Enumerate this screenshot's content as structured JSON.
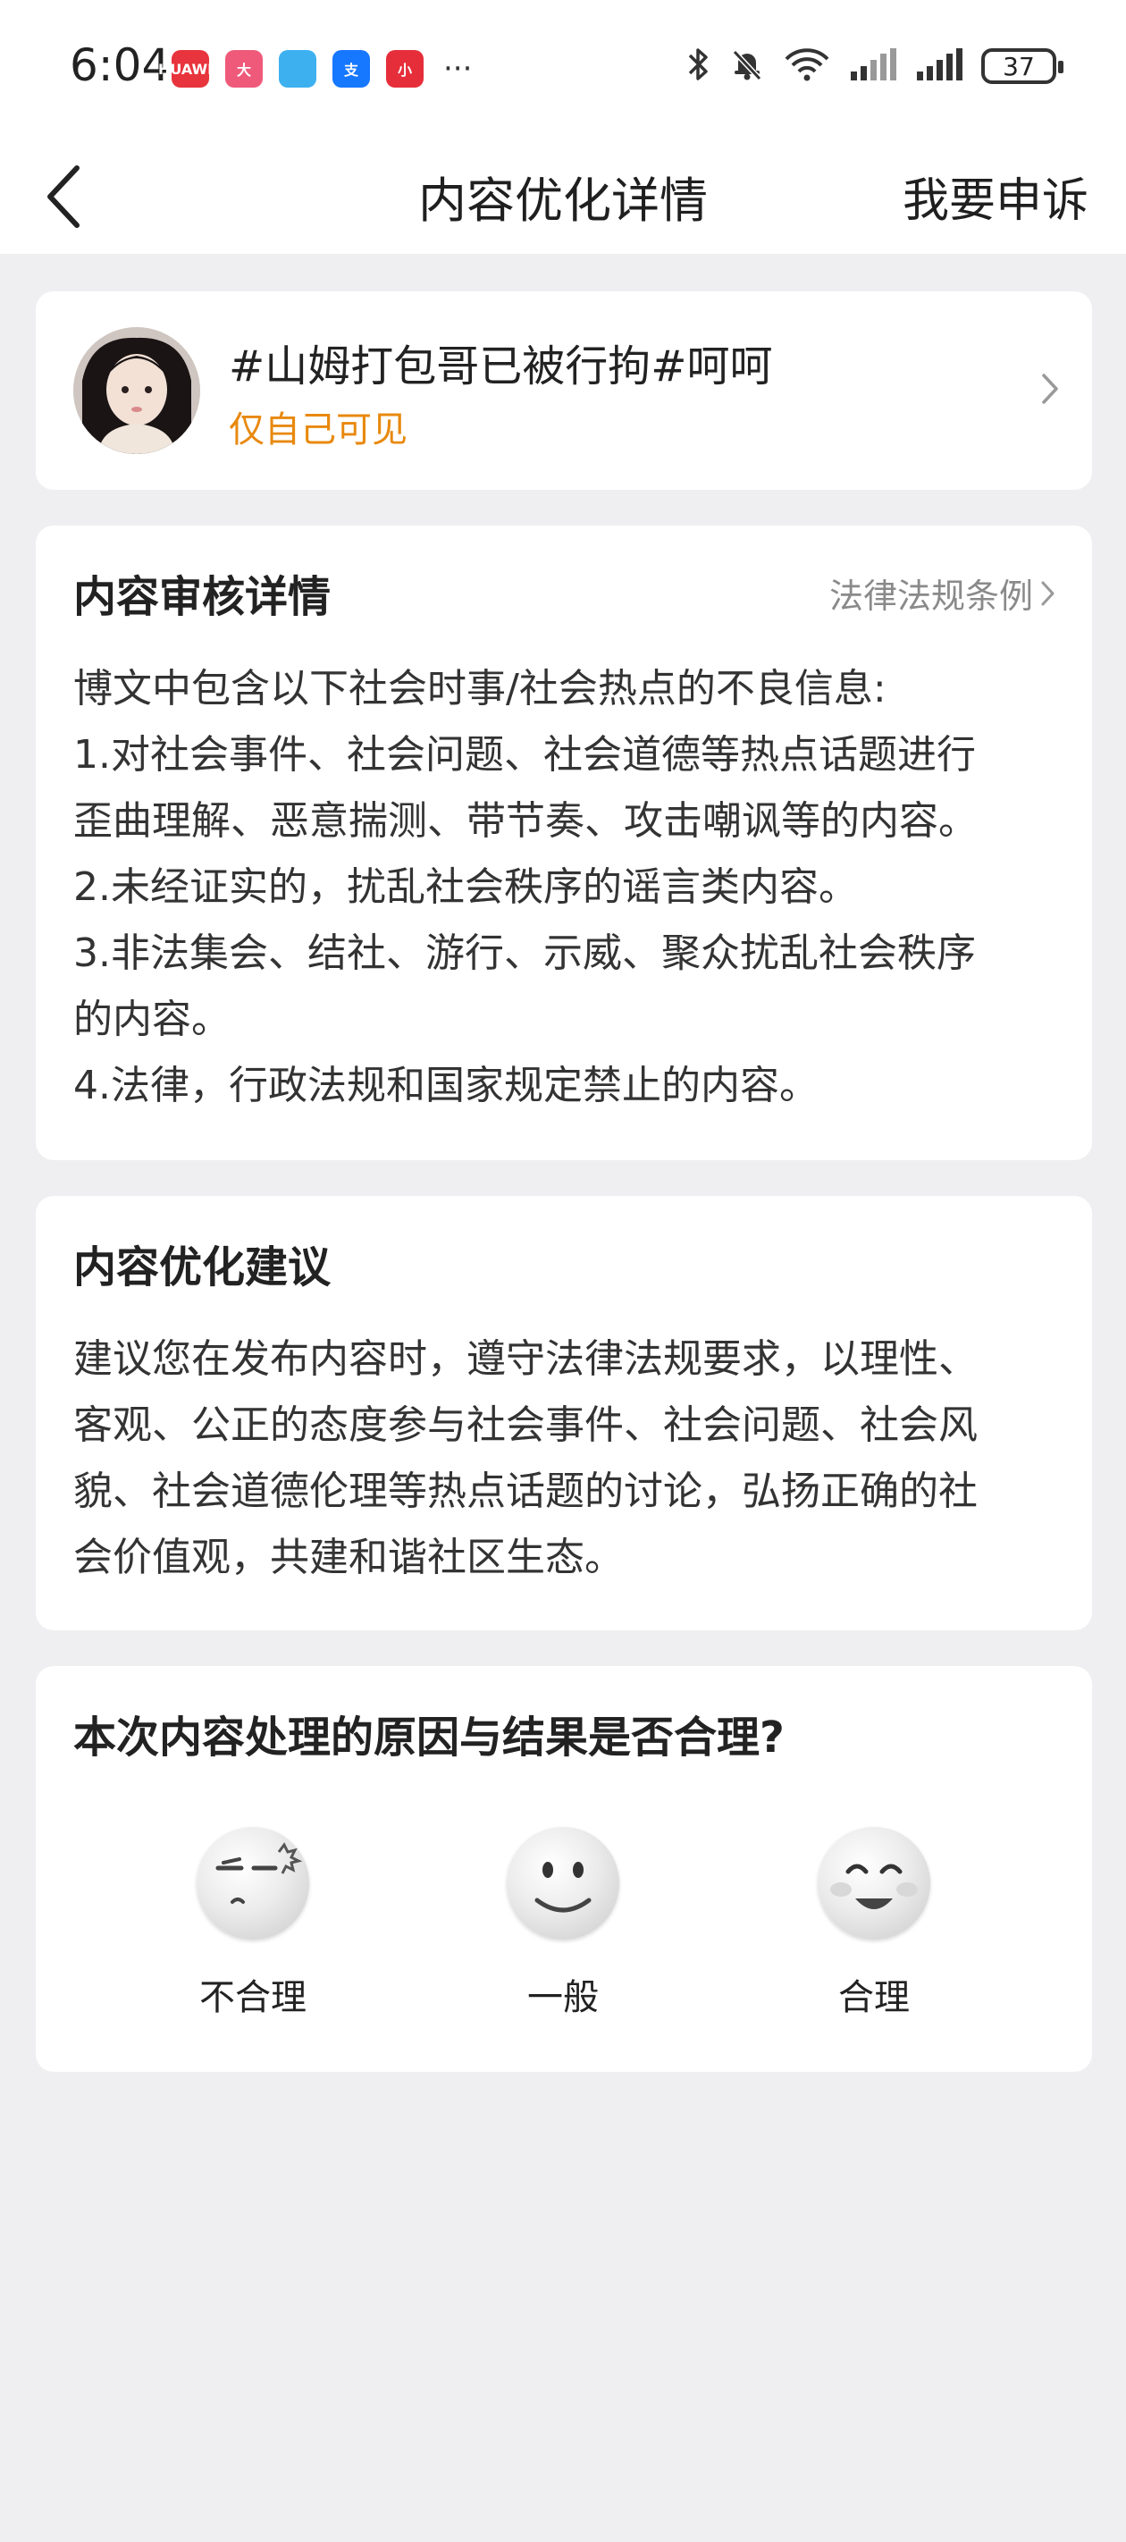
{
  "status_bar": {
    "time": "6:04",
    "app_icons": [
      {
        "name": "huawei-icon",
        "color": "#e8343c",
        "label": "HUAWEI"
      },
      {
        "name": "mascot-app-icon",
        "color": "#ef5a7a",
        "label": "大"
      },
      {
        "name": "colorful-app-icon",
        "color": "#3db0f0",
        "label": ""
      },
      {
        "name": "alipay-icon",
        "color": "#1677ff",
        "label": "支"
      },
      {
        "name": "store-app-icon",
        "color": "#e62e3a",
        "label": "小"
      }
    ],
    "more": "···",
    "battery": "37"
  },
  "nav": {
    "title": "内容优化详情",
    "appeal": "我要申诉"
  },
  "post": {
    "title": "#山姆打包哥已被行拘#呵呵",
    "visibility": "仅自己可见"
  },
  "review": {
    "heading": "内容审核详情",
    "law_link": "法律法规条例",
    "lines": [
      "博文中包含以下社会时事/社会热点的不良信息:",
      "1.对社会事件、社会问题、社会道德等热点话题进行",
      "歪曲理解、恶意揣测、带节奏、攻击嘲讽等的内容。",
      "2.未经证实的，扰乱社会秩序的谣言类内容。",
      "3.非法集会、结社、游行、示威、聚众扰乱社会秩序",
      "的内容。",
      "4.法律，行政法规和国家规定禁止的内容。"
    ]
  },
  "suggestion": {
    "heading": "内容优化建议",
    "lines": [
      "建议您在发布内容时，遵守法律法规要求，以理性、",
      "客观、公正的态度参与社会事件、社会问题、社会风",
      "貌、社会道德伦理等热点话题的讨论，弘扬正确的社",
      "会价值观，共建和谐社区生态。"
    ]
  },
  "rating": {
    "question": "本次内容处理的原因与结果是否合理?",
    "options": [
      "不合理",
      "一般",
      "合理"
    ]
  }
}
